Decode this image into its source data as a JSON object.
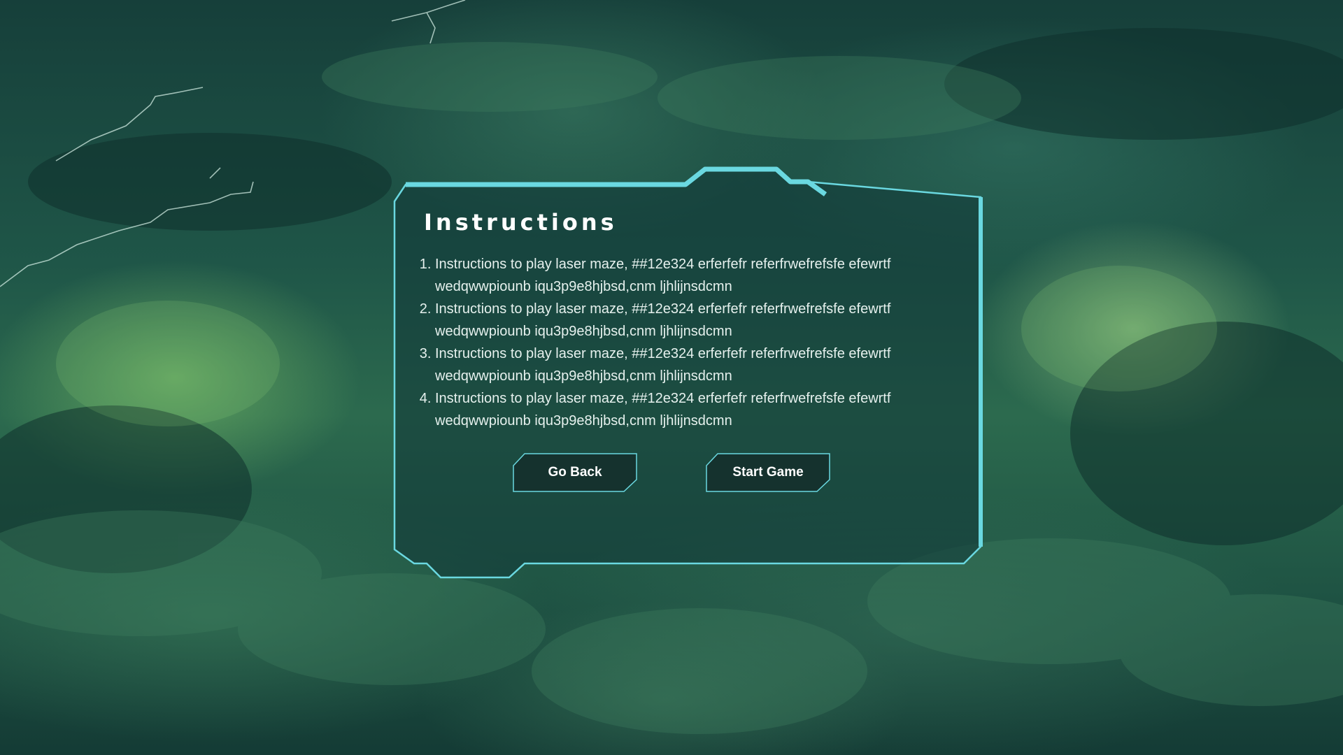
{
  "colors": {
    "accent": "#6ad8e0",
    "panel_fill": "#133c3a",
    "button_fill": "#15302c",
    "text": "#ffffff"
  },
  "instructions_panel": {
    "title": "Instructions",
    "items": [
      "Instructions to play laser maze, ##12e324 erferfefr referfrwefrefsfe efewrtf wedqwwpiounb iqu3p9e8hjbsd,cnm ljhlijnsdcmn",
      "Instructions to play laser maze, ##12e324 erferfefr referfrwefrefsfe efewrtf wedqwwpiounb iqu3p9e8hjbsd,cnm ljhlijnsdcmn",
      "Instructions to play laser maze, ##12e324 erferfefr referfrwefrefsfe efewrtf wedqwwpiounb iqu3p9e8hjbsd,cnm ljhlijnsdcmn",
      "Instructions to play laser maze, ##12e324 erferfefr referfrwefrefsfe efewrtf wedqwwpiounb iqu3p9e8hjbsd,cnm ljhlijnsdcmn"
    ],
    "buttons": {
      "go_back": "Go Back",
      "start_game": "Start Game"
    }
  }
}
